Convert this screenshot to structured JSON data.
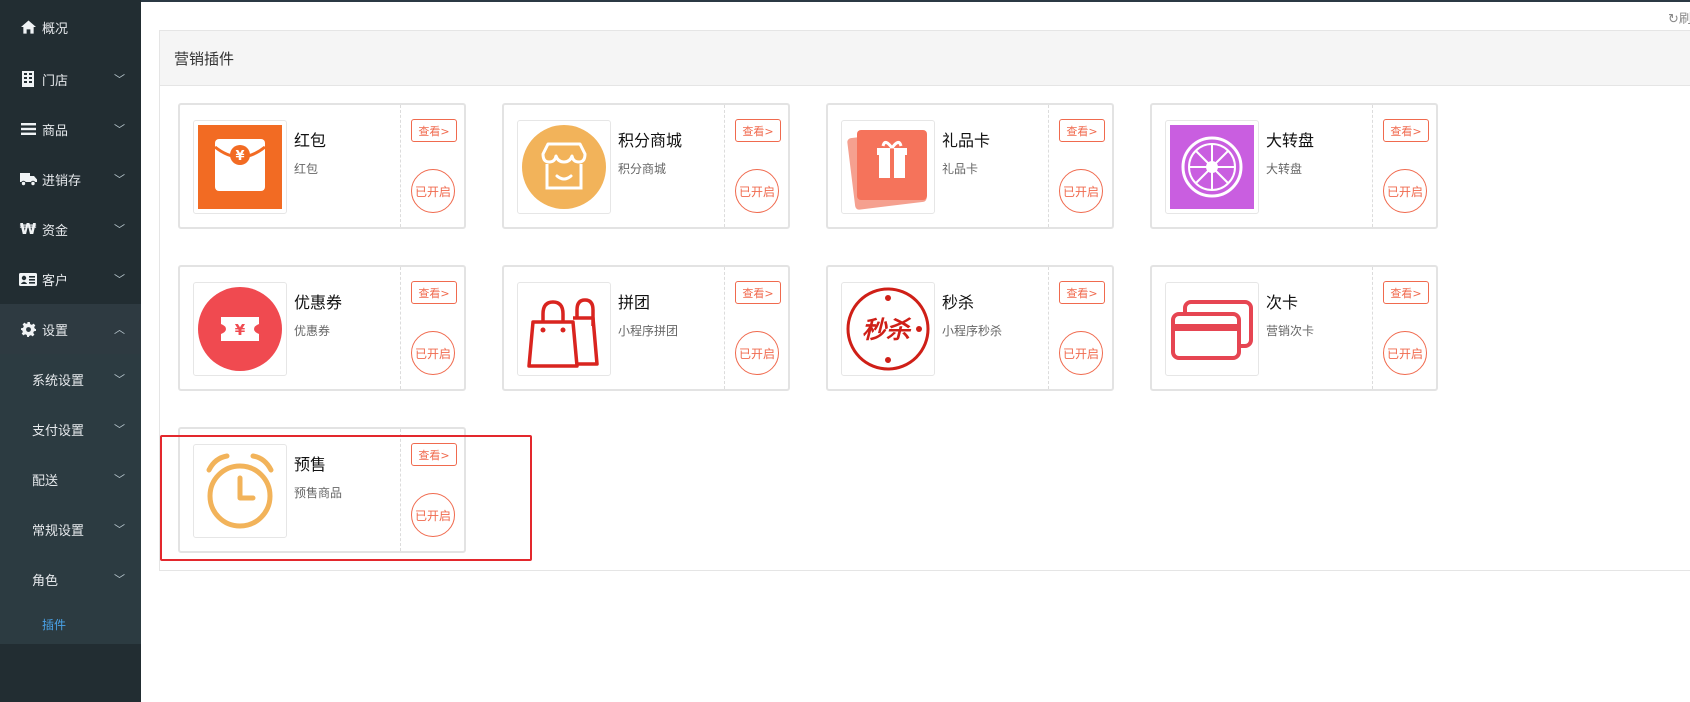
{
  "sidebar": {
    "items": [
      {
        "label": "概况",
        "icon": "home-icon",
        "chevron": ""
      },
      {
        "label": "门店",
        "icon": "building-icon",
        "chevron": "﹀"
      },
      {
        "label": "商品",
        "icon": "list-icon",
        "chevron": "﹀"
      },
      {
        "label": "进销存",
        "icon": "truck-icon",
        "chevron": "﹀"
      },
      {
        "label": "资金",
        "icon": "won-icon",
        "chevron": "﹀"
      },
      {
        "label": "客户",
        "icon": "id-card-icon",
        "chevron": "﹀"
      },
      {
        "label": "设置",
        "icon": "gear-icon",
        "chevron": "︿"
      }
    ],
    "submenu": [
      {
        "label": "系统设置",
        "chevron": "﹀"
      },
      {
        "label": "支付设置",
        "chevron": "﹀"
      },
      {
        "label": "配送",
        "chevron": "﹀"
      },
      {
        "label": "常规设置",
        "chevron": "﹀"
      },
      {
        "label": "角色",
        "chevron": "﹀"
      }
    ],
    "plugin_label": "插件"
  },
  "topbar": {
    "refresh_text": "↻刷新"
  },
  "panel": {
    "title": "营销插件"
  },
  "plugins": [
    {
      "title": "红包",
      "desc": "红包",
      "view_label": "查看>",
      "status_label": "已开启",
      "icon": "red-envelope-icon",
      "color": "#f26b23"
    },
    {
      "title": "积分商城",
      "desc": "积分商城",
      "view_label": "查看>",
      "status_label": "已开启",
      "icon": "store-icon",
      "color": "#f2b35a"
    },
    {
      "title": "礼品卡",
      "desc": "礼品卡",
      "view_label": "查看>",
      "status_label": "已开启",
      "icon": "gift-card-icon",
      "color": "#f5735b"
    },
    {
      "title": "大转盘",
      "desc": "大转盘",
      "view_label": "查看>",
      "status_label": "已开启",
      "icon": "wheel-icon",
      "color": "#c95ee0"
    },
    {
      "title": "优惠券",
      "desc": "优惠券",
      "view_label": "查看>",
      "status_label": "已开启",
      "icon": "coupon-icon",
      "color": "#f04a50"
    },
    {
      "title": "拼团",
      "desc": "小程序拼团",
      "view_label": "查看>",
      "status_label": "已开启",
      "icon": "shopping-bags-icon",
      "color": "#d9241f"
    },
    {
      "title": "秒杀",
      "desc": "小程序秒杀",
      "view_label": "查看>",
      "status_label": "已开启",
      "icon": "flash-sale-icon",
      "color": "#cf1f17",
      "icon_text": "秒杀"
    },
    {
      "title": "次卡",
      "desc": "营销次卡",
      "view_label": "查看>",
      "status_label": "已开启",
      "icon": "cards-icon",
      "color": "#e64552"
    },
    {
      "title": "预售",
      "desc": "预售商品",
      "view_label": "查看>",
      "status_label": "已开启",
      "icon": "alarm-clock-icon",
      "color": "#f2b35a"
    }
  ]
}
